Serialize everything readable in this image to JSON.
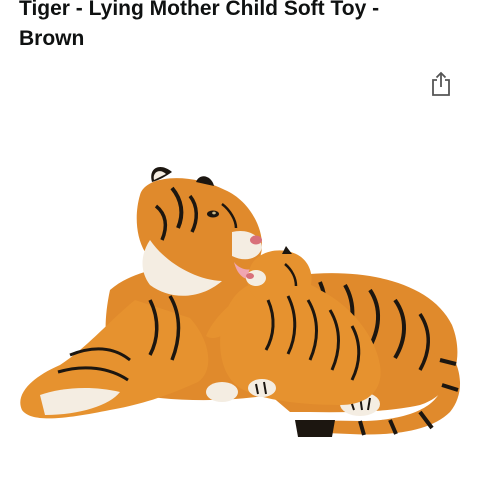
{
  "product": {
    "title": "Tiger - Lying Mother Child Soft Toy - Brown"
  },
  "actions": {
    "share_icon": "share-icon"
  },
  "image": {
    "subject": "plush-tiger-mother-and-cub-icon",
    "colors": {
      "fur": "#e08a2c",
      "belly": "#f6f0e6",
      "stripe": "#1c1610"
    }
  }
}
